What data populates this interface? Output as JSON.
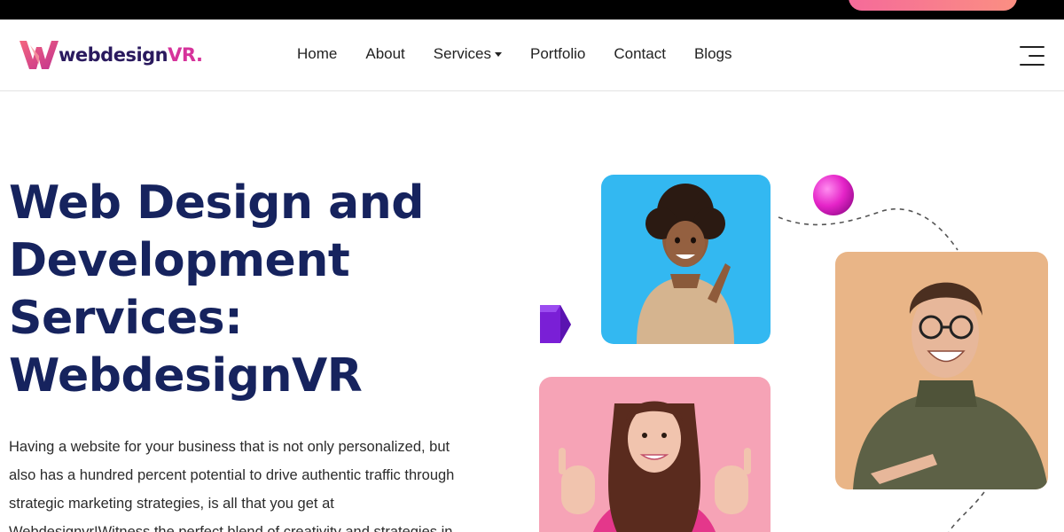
{
  "brand": {
    "logo_text": "webdesign",
    "logo_accent": "VR.",
    "colors": {
      "primary": "#16235e",
      "accent": "#d6339b",
      "cta_gradient": [
        "#f56a9a",
        "#fb8f82"
      ]
    }
  },
  "nav": {
    "items": [
      {
        "label": "Home",
        "dropdown": false
      },
      {
        "label": "About",
        "dropdown": false
      },
      {
        "label": "Services",
        "dropdown": true
      },
      {
        "label": "Portfolio",
        "dropdown": false
      },
      {
        "label": "Contact",
        "dropdown": false
      },
      {
        "label": "Blogs",
        "dropdown": false
      }
    ],
    "menu_icon": "hamburger-icon"
  },
  "hero": {
    "title_lines": [
      "Web Design and",
      "Development",
      "Services:",
      "WebdesignVR"
    ],
    "paragraph_lines": [
      "Having a website for your business that is not only personalized, but",
      "also has a hundred percent potential to drive authentic traffic through",
      "strategic marketing strategies, is all that you get at",
      "Webdesignvr!Witness the perfect blend of creativity and strategies in"
    ]
  },
  "decor": {
    "photos": [
      "woman-pointing-photo",
      "woman-ok-gesture-photo",
      "man-smiling-glasses-photo"
    ],
    "shapes": [
      "magenta-sphere",
      "purple-cube",
      "dashed-path"
    ]
  }
}
